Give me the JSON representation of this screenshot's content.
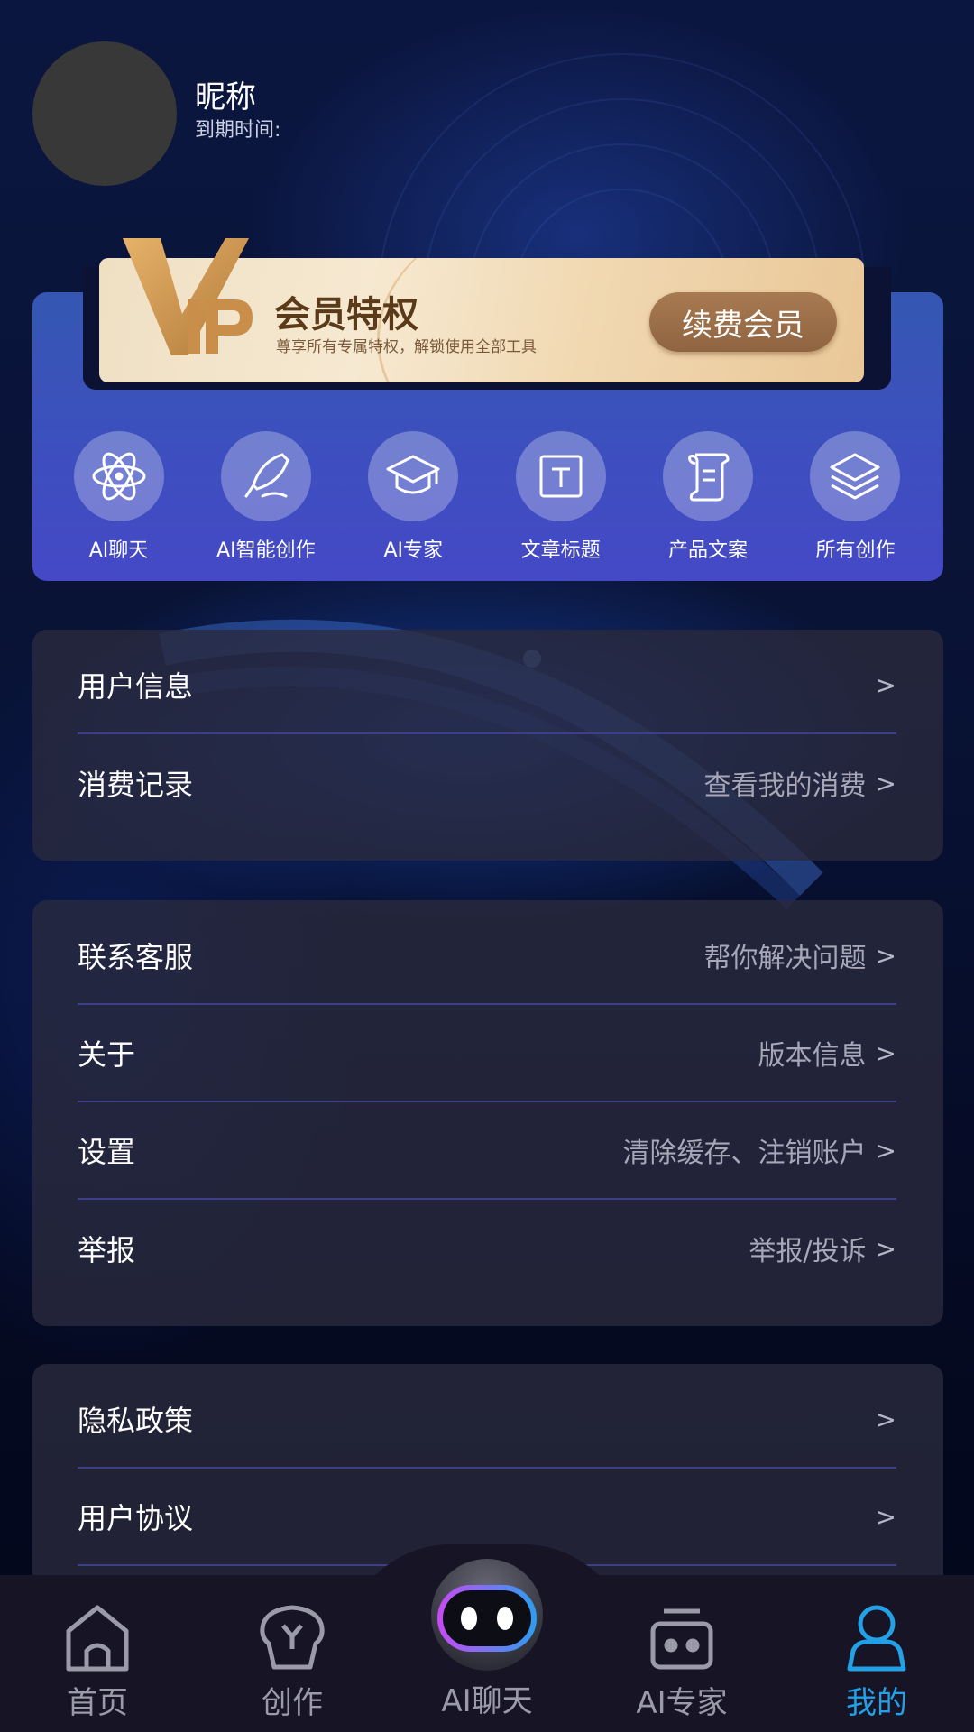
{
  "profile": {
    "nickname": "昵称",
    "expire_label": "到期时间:"
  },
  "vip": {
    "logo_text": "VIP",
    "title": "会员特权",
    "subtitle": "尊享所有专属特权，解锁使用全部工具",
    "renew_button": "续费会员",
    "accent_color": "#8f6440"
  },
  "features": [
    {
      "label": "AI聊天",
      "icon": "atom-icon"
    },
    {
      "label": "AI智能创作",
      "icon": "quill-icon"
    },
    {
      "label": "AI专家",
      "icon": "graduation-cap-icon"
    },
    {
      "label": "文章标题",
      "icon": "text-box-icon"
    },
    {
      "label": "产品文案",
      "icon": "scroll-icon"
    },
    {
      "label": "所有创作",
      "icon": "layers-icon"
    }
  ],
  "menu_group_1": [
    {
      "label": "用户信息",
      "right": "",
      "chevron": ">"
    },
    {
      "label": "消费记录",
      "right": "查看我的消费",
      "chevron": ">"
    }
  ],
  "menu_group_2": [
    {
      "label": "联系客服",
      "right": "帮你解决问题",
      "chevron": ">"
    },
    {
      "label": "关于",
      "right": "版本信息",
      "chevron": ">"
    },
    {
      "label": "设置",
      "right": "清除缓存、注销账户",
      "chevron": ">"
    },
    {
      "label": "举报",
      "right": "举报/投诉",
      "chevron": ">"
    }
  ],
  "menu_group_3": [
    {
      "label": "隐私政策",
      "right": "",
      "chevron": ">"
    },
    {
      "label": "用户协议",
      "right": "",
      "chevron": ">"
    }
  ],
  "bottom_nav": [
    {
      "label": "首页",
      "icon": "home-icon",
      "active": false
    },
    {
      "label": "创作",
      "icon": "create-icon",
      "active": false
    },
    {
      "label": "AI聊天",
      "icon": "robot-icon",
      "active": false
    },
    {
      "label": "AI专家",
      "icon": "expert-bot-icon",
      "active": false
    },
    {
      "label": "我的",
      "icon": "user-icon",
      "active": true
    }
  ],
  "colors": {
    "active_nav": "#23a0e6",
    "panel_blue": "#3d4fbf",
    "divider": "#3d3f8a"
  }
}
